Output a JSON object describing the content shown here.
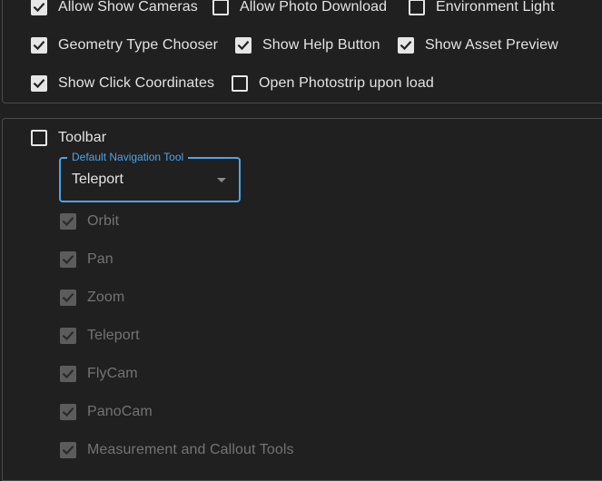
{
  "general_options": {
    "allow_show_cameras": {
      "label": "Allow Show Cameras",
      "checked": true
    },
    "allow_photo_download": {
      "label": "Allow Photo Download",
      "checked": false
    },
    "environment_light": {
      "label": "Environment Light",
      "checked": false
    },
    "geometry_type_chooser": {
      "label": "Geometry Type Chooser",
      "checked": true
    },
    "show_help_button": {
      "label": "Show Help Button",
      "checked": true
    },
    "show_asset_preview": {
      "label": "Show Asset Preview",
      "checked": true
    },
    "show_click_coordinates": {
      "label": "Show Click Coordinates",
      "checked": true
    },
    "open_photostrip": {
      "label": "Open Photostrip upon load",
      "checked": false
    }
  },
  "toolbar": {
    "label": "Toolbar",
    "checked": false,
    "default_navigation_tool": {
      "legend": "Default Navigation Tool",
      "value": "Teleport"
    },
    "tools": [
      {
        "label": "Orbit",
        "checked": true,
        "disabled": true
      },
      {
        "label": "Pan",
        "checked": true,
        "disabled": true
      },
      {
        "label": "Zoom",
        "checked": true,
        "disabled": true
      },
      {
        "label": "Teleport",
        "checked": true,
        "disabled": true
      },
      {
        "label": "FlyCam",
        "checked": true,
        "disabled": true
      },
      {
        "label": "PanoCam",
        "checked": true,
        "disabled": true
      },
      {
        "label": "Measurement and Callout Tools",
        "checked": true,
        "disabled": true
      }
    ]
  },
  "colors": {
    "background": "#202020",
    "accent": "#4fa3e8",
    "text": "#e3e3e3",
    "disabled_text": "#737373"
  }
}
